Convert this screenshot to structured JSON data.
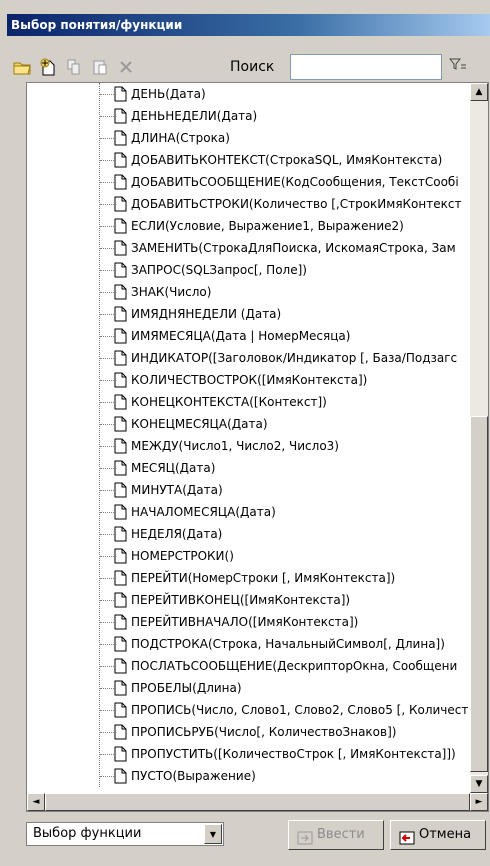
{
  "window": {
    "title": "Выбор понятия/функции"
  },
  "toolbar": {
    "search_label": "Поиск",
    "search_value": "",
    "buttons": [
      "folder-open-icon",
      "new-item-icon",
      "copy-icon",
      "paste-icon",
      "delete-icon",
      "filter-icon"
    ]
  },
  "tree": {
    "items": [
      "ДЕНЬ(Дата)",
      "ДЕНЬНЕДЕЛИ(Дата)",
      "ДЛИНА(Строка)",
      "ДОБАВИТЬКОНТЕКСТ(СтрокаSQL, ИмяКонтекста)",
      "ДОБАВИТЬСООБЩЕНИЕ(КодСообщения, ТекстСообі",
      "ДОБАВИТЬСТРОКИ(Количество [,СтрокИмяКонтекст",
      "ЕСЛИ(Условие, Выражение1, Выражение2)",
      "ЗАМЕНИТЬ(СтрокаДляПоиска, ИскомаяСтрока, Зам",
      "ЗАПРОС(SQLЗапрос[, Поле])",
      "ЗНАК(Число)",
      "ИМЯДНЯНЕДЕЛИ (Дата)",
      "ИМЯМЕСЯЦА(Дата | НомерМесяца)",
      "ИНДИКАТОР([Заголовок/Индикатор [, База/Подзагс",
      "КОЛИЧЕСТВОСТРОК([ИмяКонтекста])",
      "КОНЕЦКОНТЕКСТА([Контекст])",
      "КОНЕЦМЕСЯЦА(Дата)",
      "МЕЖДУ(Число1, Число2, Число3)",
      "МЕСЯЦ(Дата)",
      "МИНУТА(Дата)",
      "НАЧАЛОМЕСЯЦА(Дата)",
      "НЕДЕЛЯ(Дата)",
      "НОМЕРСТРОКИ()",
      "ПЕРЕЙТИ(НомерСтроки [, ИмяКонтекста])",
      "ПЕРЕЙТИВКОНЕЦ([ИмяКонтекста])",
      "ПЕРЕЙТИВНАЧАЛО([ИмяКонтекста])",
      "ПОДСТРОКА(Строка, НачальныйСимвол[, Длина])",
      "ПОСЛАТЬСООБЩЕНИЕ(ДескрипторОкна, Сообщени",
      "ПРОБЕЛЫ(Длина)",
      "ПРОПИСЬ(Число, Слово1, Слово2, Слово5 [, Количест",
      "ПРОПИСЬРУБ(Число[, КоличествоЗнаков])",
      "ПРОПУСТИТЬ([КоличествоСтрок [, ИмяКонтекста]])",
      "ПУСТО(Выражение)"
    ]
  },
  "bottom": {
    "combo_value": "Выбор функции",
    "enter_label": "Ввести",
    "cancel_label": "Отмена"
  },
  "colors": {
    "titlebar_start": "#0a246a",
    "titlebar_end": "#a6caf0",
    "face": "#d4d0c8"
  }
}
